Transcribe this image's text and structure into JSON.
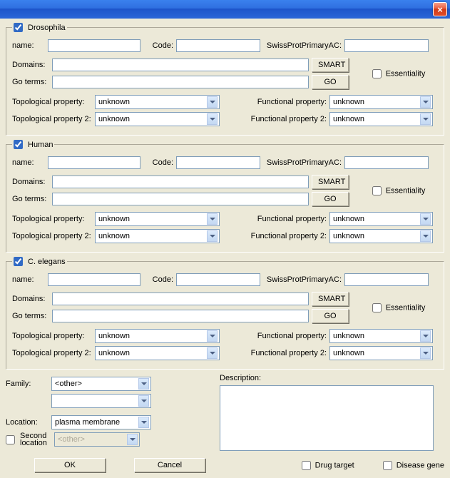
{
  "window": {
    "close_label": "×"
  },
  "organisms": [
    {
      "id": "drosophila",
      "title": "Drosophila",
      "checked": true,
      "labels": {
        "name": "name:",
        "code": "Code:",
        "swiss": "SwissProtPrimaryAC:",
        "domains": "Domains:",
        "goterms": "Go terms:",
        "smart": "SMART",
        "go": "GO",
        "essentiality": "Essentiality",
        "topo1": "Topological property:",
        "topo2": "Topological property 2:",
        "func1": "Functional property:",
        "func2": "Functional property 2:"
      },
      "values": {
        "name": "",
        "code": "",
        "swiss": "",
        "domains": "",
        "goterms": "",
        "essentiality": false,
        "topo1": "unknown",
        "topo2": "unknown",
        "func1": "unknown",
        "func2": "unknown"
      }
    },
    {
      "id": "human",
      "title": "Human",
      "checked": true,
      "labels": {
        "name": "name:",
        "code": "Code:",
        "swiss": "SwissProtPrimaryAC:",
        "domains": "Domains:",
        "goterms": "Go terms:",
        "smart": "SMART",
        "go": "GO",
        "essentiality": "Essentiality",
        "topo1": "Topological property:",
        "topo2": "Topological property 2:",
        "func1": "Functional property:",
        "func2": "Functional property 2:"
      },
      "values": {
        "name": "",
        "code": "",
        "swiss": "",
        "domains": "",
        "goterms": "",
        "essentiality": false,
        "topo1": "unknown",
        "topo2": "unknown",
        "func1": "unknown",
        "func2": "unknown"
      }
    },
    {
      "id": "celegans",
      "title": "C. elegans",
      "checked": true,
      "labels": {
        "name": "name:",
        "code": "Code:",
        "swiss": "SwissProtPrimaryAC:",
        "domains": "Domains:",
        "goterms": "Go terms:",
        "smart": "SMART",
        "go": "GO",
        "essentiality": "Essentiality",
        "topo1": "Topological property:",
        "topo2": "Topological property 2:",
        "func1": "Functional property:",
        "func2": "Functional property 2:"
      },
      "values": {
        "name": "",
        "code": "",
        "swiss": "",
        "domains": "",
        "goterms": "",
        "essentiality": false,
        "topo1": "unknown",
        "topo2": "unknown",
        "func1": "unknown",
        "func2": "unknown"
      }
    }
  ],
  "bottom": {
    "family_label": "Family:",
    "family_value": "<other>",
    "family2_value": "",
    "location_label": "Location:",
    "location_value": "plasma membrane",
    "second_loc_label_a": "Second",
    "second_loc_label_b": "location",
    "second_loc_checked": false,
    "second_loc_value": "<other>",
    "description_label": "Description:",
    "description_value": "",
    "ok": "OK",
    "cancel": "Cancel",
    "drug_target": "Drug target",
    "drug_target_checked": false,
    "disease_gene": "Disease gene",
    "disease_gene_checked": false
  }
}
